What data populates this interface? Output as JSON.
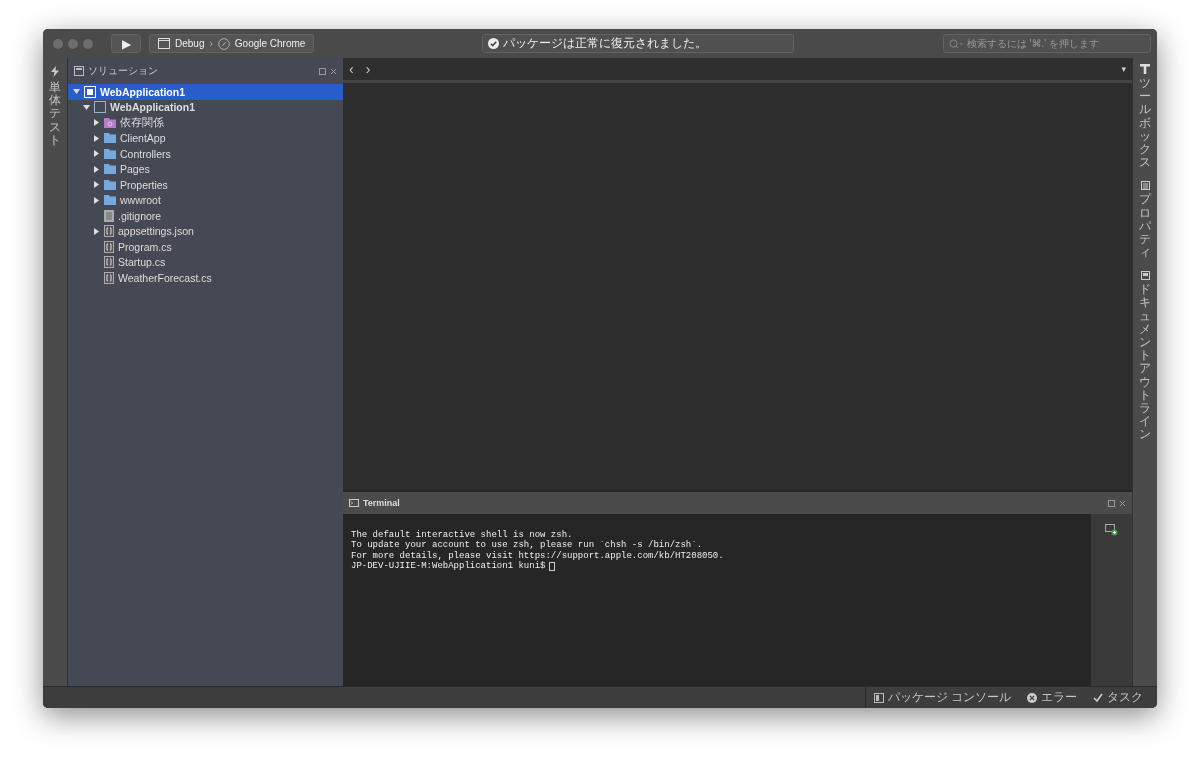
{
  "toolbar": {
    "run_button": "▶",
    "configuration": "Debug",
    "separator": "›",
    "target": "Google Chrome",
    "status_message": "パッケージは正常に復元されました。",
    "search": {
      "placeholder": "検索するには '⌘.' を押します"
    }
  },
  "left_dock": {
    "tabs": [
      {
        "label": "単体テスト"
      }
    ]
  },
  "solution": {
    "title": "ソリューション",
    "tree": [
      {
        "label": "WebApplication1",
        "kind": "solution",
        "selected": true,
        "expanded": true,
        "children": [
          {
            "label": "WebApplication1",
            "kind": "project",
            "selected": false,
            "expanded": true,
            "children": [
              {
                "label": "依存関係",
                "kind": "dependencies",
                "selected": false,
                "expanded": false
              },
              {
                "label": "ClientApp",
                "kind": "folder",
                "selected": false,
                "expanded": false
              },
              {
                "label": "Controllers",
                "kind": "folder",
                "selected": false,
                "expanded": false
              },
              {
                "label": "Pages",
                "kind": "folder",
                "selected": false,
                "expanded": false
              },
              {
                "label": "Properties",
                "kind": "folder",
                "selected": false,
                "expanded": false
              },
              {
                "label": "wwwroot",
                "kind": "folder",
                "selected": false,
                "expanded": false
              },
              {
                "label": ".gitignore",
                "kind": "file",
                "selected": false
              },
              {
                "label": "appsettings.json",
                "kind": "code",
                "selected": false,
                "expanded": false
              },
              {
                "label": "Program.cs",
                "kind": "code",
                "selected": false
              },
              {
                "label": "Startup.cs",
                "kind": "code",
                "selected": false
              },
              {
                "label": "WeatherForecast.cs",
                "kind": "code",
                "selected": false
              }
            ]
          }
        ]
      }
    ]
  },
  "editor": {
    "back": "‹",
    "forward": "›",
    "menu": "▾"
  },
  "terminal": {
    "title": "Terminal",
    "lines": [
      "The default interactive shell is now zsh.",
      "To update your account to use zsh, please run `chsh -s /bin/zsh`.",
      "For more details, please visit https://support.apple.com/kb/HT208050.",
      "JP-DEV-UJIIE-M:WebApplication1 kuni$"
    ]
  },
  "right_dock": {
    "tabs": [
      {
        "label": "ツールボックス",
        "kind": "toolbox"
      },
      {
        "label": "プロパティ",
        "kind": "properties"
      },
      {
        "label": "ドキュメントアウトライン",
        "kind": "outline"
      }
    ]
  },
  "status_bar": {
    "items": [
      {
        "label": "パッケージ コンソール",
        "kind": "console"
      },
      {
        "label": "エラー",
        "kind": "error"
      },
      {
        "label": "タスク",
        "kind": "tasks"
      }
    ]
  }
}
